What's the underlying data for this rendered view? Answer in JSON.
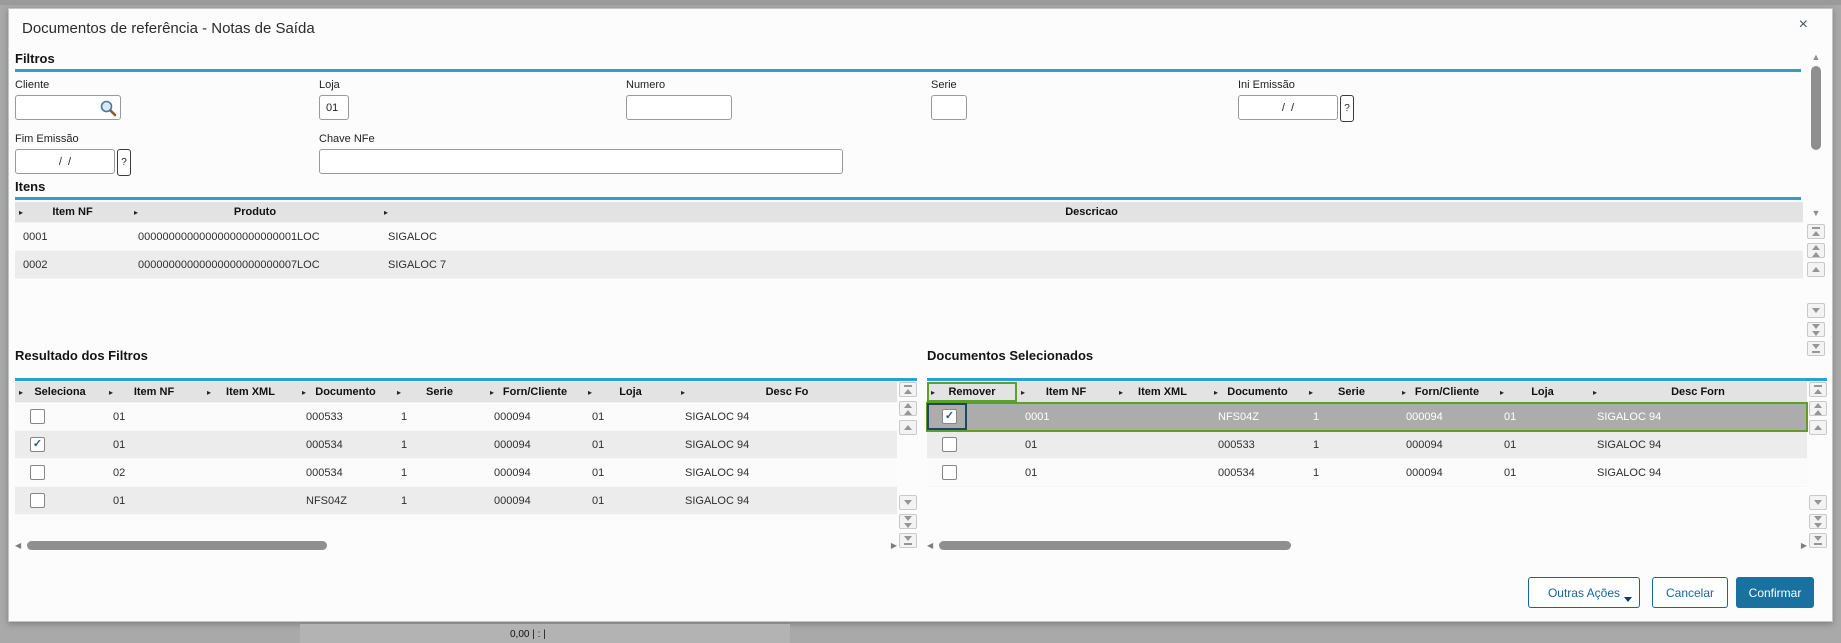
{
  "window": {
    "title": "Documentos de referência - Notas de Saída"
  },
  "icons": {
    "close": "×",
    "sort": "▸",
    "check": "✓",
    "scroll_up": "▲",
    "scroll_down": "▼",
    "scroll_left": "◀",
    "scroll_right": "▶",
    "search": "magnifier",
    "help": "?"
  },
  "colors": {
    "section_line_blue": "#2b9fd8",
    "button_blue": "#1565a0",
    "confirm_fill_blue": "#19719f",
    "selection_green": "#5ca02c",
    "selected_row_gray": "#acacac",
    "grid_header_gray": "#e3e3e3"
  },
  "filters": {
    "section_title": "Filtros",
    "cliente": {
      "label": "Cliente",
      "value": ""
    },
    "loja": {
      "label": "Loja",
      "value": "01"
    },
    "numero": {
      "label": "Numero",
      "value": ""
    },
    "serie": {
      "label": "Serie",
      "value": ""
    },
    "ini_emissao": {
      "label": "Ini Emissão",
      "value": "/  /",
      "help": "?"
    },
    "fim_emissao": {
      "label": "Fim Emissão",
      "value": "/  /",
      "help": "?"
    },
    "chave_nfe": {
      "label": "Chave NFe",
      "value": ""
    }
  },
  "itens": {
    "section_title": "Itens",
    "headers": [
      "Item NF",
      "Produto",
      "Descricao"
    ],
    "rows": [
      {
        "cells": [
          "0001",
          "00000000000000000000000001LOC",
          "SIGALOC"
        ]
      },
      {
        "cells": [
          "0002",
          "00000000000000000000000007LOC",
          "SIGALOC 7"
        ]
      }
    ]
  },
  "resultado": {
    "section_title": "Resultado dos Filtros",
    "headers": [
      "Seleciona",
      "Item NF",
      "Item XML",
      "Documento",
      "Serie",
      "Forn/Cliente",
      "Loja",
      "Desc Fo"
    ],
    "rows": [
      {
        "checked": false,
        "cells": [
          "01",
          "",
          "000533",
          "1",
          "000094",
          "01",
          "SIGALOC 94"
        ]
      },
      {
        "checked": true,
        "cells": [
          "01",
          "",
          "000534",
          "1",
          "000094",
          "01",
          "SIGALOC 94"
        ]
      },
      {
        "checked": false,
        "cells": [
          "02",
          "",
          "000534",
          "1",
          "000094",
          "01",
          "SIGALOC 94"
        ]
      },
      {
        "checked": false,
        "cells": [
          "01",
          "",
          "NFS04Z",
          "1",
          "000094",
          "01",
          "SIGALOC 94"
        ]
      }
    ]
  },
  "selecionados": {
    "section_title": "Documentos Selecionados",
    "headers": [
      "Remover",
      "Item NF",
      "Item XML",
      "Documento",
      "Serie",
      "Forn/Cliente",
      "Loja",
      "Desc Forn"
    ],
    "rows": [
      {
        "checked": true,
        "selected": true,
        "cells": [
          "0001",
          "",
          "NFS04Z",
          "1",
          "000094",
          "01",
          "SIGALOC 94"
        ]
      },
      {
        "checked": false,
        "cells": [
          "01",
          "",
          "000533",
          "1",
          "000094",
          "01",
          "SIGALOC 94"
        ]
      },
      {
        "checked": false,
        "cells": [
          "01",
          "",
          "000534",
          "1",
          "000094",
          "01",
          "SIGALOC 94"
        ]
      }
    ]
  },
  "footer": {
    "outras_acoes": "Outras Ações",
    "cancelar": "Cancelar",
    "confirmar": "Confirmar"
  },
  "background_window": {
    "fragment": "0,00 | : |"
  }
}
